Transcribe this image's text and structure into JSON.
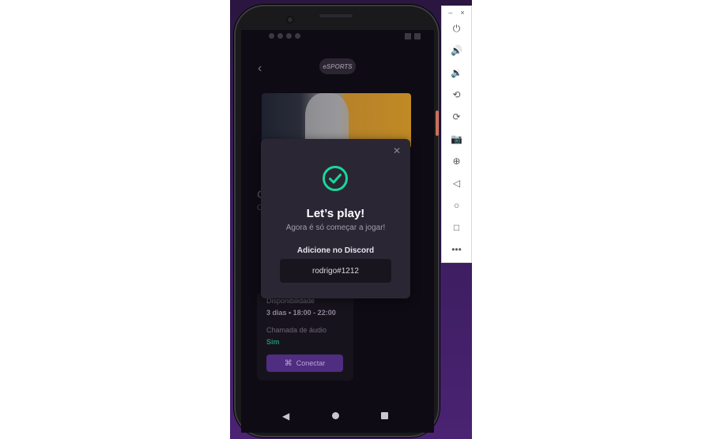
{
  "emulator_controls": {
    "minimize_label": "–",
    "close_label": "×",
    "tools": [
      {
        "name": "power-icon",
        "glyph": "⏻"
      },
      {
        "name": "volume-up-icon",
        "glyph": "🔊"
      },
      {
        "name": "volume-down-icon",
        "glyph": "🔉"
      },
      {
        "name": "rotate-left-icon",
        "glyph": "⟲"
      },
      {
        "name": "rotate-right-icon",
        "glyph": "⟳"
      },
      {
        "name": "camera-icon",
        "glyph": "📷"
      },
      {
        "name": "zoom-icon",
        "glyph": "⊕"
      },
      {
        "name": "back-icon",
        "glyph": "◁"
      },
      {
        "name": "home-icon",
        "glyph": "○"
      },
      {
        "name": "overview-icon",
        "glyph": "□"
      },
      {
        "name": "more-icon",
        "glyph": "•••"
      }
    ]
  },
  "app": {
    "back_glyph": "‹",
    "game_fragment_title": "C",
    "game_fragment_sub": "C",
    "availability_label": "Disponibilidade",
    "availability_value": "3 dias • 18:00 - 22:00",
    "audio_label": "Chamada de áudio",
    "audio_value": "Sim",
    "connect_label": "Conectar"
  },
  "modal": {
    "close_glyph": "✕",
    "title": "Let’s play!",
    "subtitle": "Agora é só começar a jogar!",
    "discord_label": "Adicione no Discord",
    "discord_user": "rodrigo#1212"
  },
  "colors": {
    "accent_green": "#1bd69a",
    "button_purple": "#4f2d80",
    "modal_bg": "#2a2634"
  }
}
